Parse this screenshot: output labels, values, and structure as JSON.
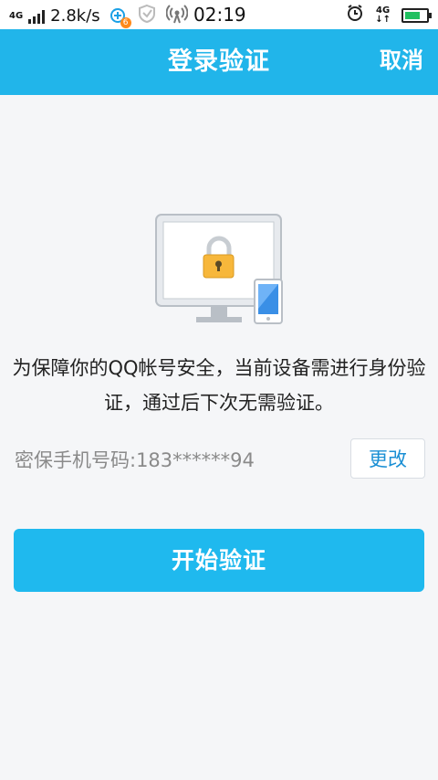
{
  "status_bar": {
    "network": "4G",
    "speed": "2.8k/s",
    "time": "02:19",
    "network_right": "4G",
    "notification_badge": "6",
    "icons": [
      "signal-icon",
      "notification-icon",
      "shield-icon",
      "wifi-hotspot-icon",
      "alarm-icon",
      "data-arrows-icon",
      "battery-icon"
    ]
  },
  "header": {
    "title": "登录验证",
    "cancel_label": "取消"
  },
  "illustration": {
    "icons": [
      "monitor-icon",
      "lock-icon",
      "phone-icon"
    ]
  },
  "main": {
    "message": "为保障你的QQ帐号安全，当前设备需进行身份验证，通过后下次无需验证。",
    "phone_label": "密保手机号码:183******94",
    "change_label": "更改",
    "start_label": "开始验证"
  },
  "colors": {
    "accent": "#21b5ea",
    "button": "#1fb9ee",
    "link": "#1a8fd4",
    "background": "#f5f6f8"
  }
}
